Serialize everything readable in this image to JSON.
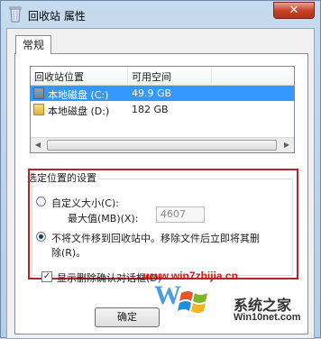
{
  "window": {
    "title": "回收站 属性",
    "close_label": "✕"
  },
  "tabs": [
    {
      "label": "常规"
    }
  ],
  "list": {
    "columns": [
      "回收站位置",
      "可用空间"
    ],
    "rows": [
      {
        "location": "本地磁盘 (C:)",
        "free": "49.9 GB",
        "selected": true
      },
      {
        "location": "本地磁盘 (D:)",
        "free": "182 GB",
        "selected": false
      }
    ]
  },
  "settings": {
    "group_label": "选定位置的设置",
    "custom_size_label": "自定义大小(C):",
    "max_label": "最大值(MB)(X):",
    "max_value": "4607",
    "no_move_label_line1": "不将文件移到回收站中。移除文件后立即将其删",
    "no_move_label_line2": "除(R)。",
    "selected_option": "no_move"
  },
  "confirm_checkbox": {
    "label": "显示删除确认对话框(D)",
    "checked": true
  },
  "buttons": {
    "ok": "确定"
  },
  "watermark": {
    "url": "www.win7zhijia.cn",
    "brand_cn": "系统之家",
    "brand_en": "Win10net.com"
  },
  "colors": {
    "selection": "#3399ff",
    "highlight_frame": "#b2262a",
    "url": "#d41a1a"
  }
}
